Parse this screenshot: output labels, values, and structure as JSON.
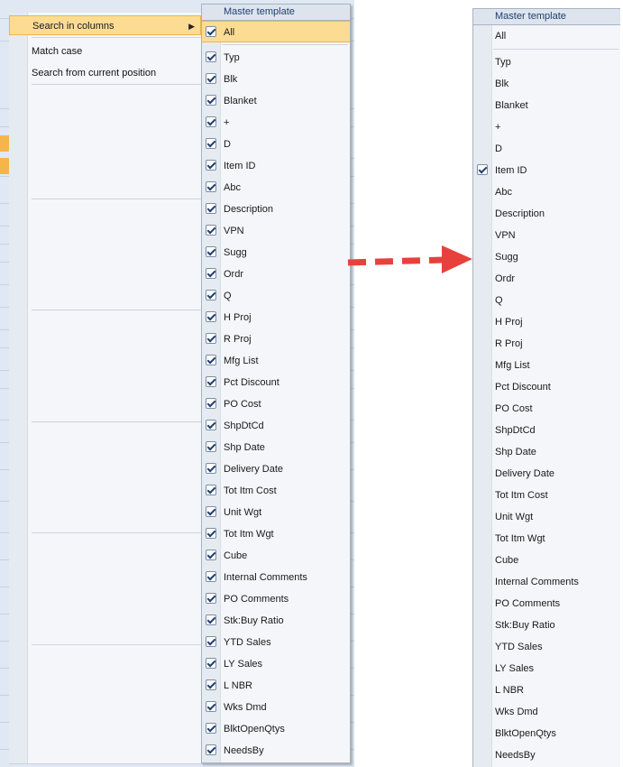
{
  "left_menu": {
    "items": [
      {
        "label": "Search in columns",
        "state": "highlight",
        "submenu": true
      },
      {
        "label": "Match case",
        "state": "active"
      },
      {
        "label": "Search from current position",
        "state": "active"
      },
      {
        "label": "",
        "state": "disabled"
      },
      {
        "label": "",
        "state": "disabled"
      },
      {
        "label": "",
        "state": "disabled"
      },
      {
        "label": "",
        "state": "disabled"
      },
      {
        "label": "",
        "state": "disabled"
      },
      {
        "label": "",
        "state": "disabled"
      },
      {
        "label": "",
        "state": "disabled"
      },
      {
        "label": "",
        "state": "disabled"
      },
      {
        "label": "",
        "state": "disabled"
      },
      {
        "label": "",
        "state": "disabled"
      },
      {
        "label": "",
        "state": "disabled"
      },
      {
        "label": "",
        "state": "disabled"
      },
      {
        "label": "",
        "state": "disabled"
      },
      {
        "label": "",
        "state": "disabled"
      },
      {
        "label": "",
        "state": "disabled"
      },
      {
        "label": "",
        "state": "disabled"
      },
      {
        "label": "",
        "state": "disabled"
      },
      {
        "label": "",
        "state": "disabled"
      },
      {
        "label": "",
        "state": "disabled"
      },
      {
        "label": "",
        "state": "disabled"
      },
      {
        "label": "",
        "state": "disabled"
      },
      {
        "label": "",
        "state": "disabled"
      },
      {
        "label": "",
        "state": "disabled"
      },
      {
        "label": "",
        "state": "disabled"
      },
      {
        "label": "",
        "state": "disabled"
      },
      {
        "label": "",
        "state": "disabled"
      },
      {
        "label": "",
        "state": "disabled"
      },
      {
        "label": "",
        "state": "disabled"
      },
      {
        "label": "",
        "state": "disabled"
      }
    ]
  },
  "panel_before": {
    "title": "Master template",
    "all": {
      "label": "All",
      "checked": true
    },
    "columns": [
      {
        "label": "Typ",
        "checked": true
      },
      {
        "label": "Blk",
        "checked": true
      },
      {
        "label": "Blanket",
        "checked": true
      },
      {
        "label": "+",
        "checked": true
      },
      {
        "label": "D",
        "checked": true
      },
      {
        "label": "Item ID",
        "checked": true
      },
      {
        "label": "Abc",
        "checked": true
      },
      {
        "label": "Description",
        "checked": true
      },
      {
        "label": "VPN",
        "checked": true
      },
      {
        "label": "Sugg",
        "checked": true
      },
      {
        "label": "Ordr",
        "checked": true
      },
      {
        "label": "Q",
        "checked": true
      },
      {
        "label": "H Proj",
        "checked": true
      },
      {
        "label": "R Proj",
        "checked": true
      },
      {
        "label": "Mfg List",
        "checked": true
      },
      {
        "label": "Pct Discount",
        "checked": true
      },
      {
        "label": "PO Cost",
        "checked": true
      },
      {
        "label": "ShpDtCd",
        "checked": true
      },
      {
        "label": "Shp Date",
        "checked": true
      },
      {
        "label": "Delivery Date",
        "checked": true
      },
      {
        "label": "Tot Itm Cost",
        "checked": true
      },
      {
        "label": "Unit Wgt",
        "checked": true
      },
      {
        "label": "Tot Itm Wgt",
        "checked": true
      },
      {
        "label": "Cube",
        "checked": true
      },
      {
        "label": "Internal Comments",
        "checked": true
      },
      {
        "label": "PO Comments",
        "checked": true
      },
      {
        "label": "Stk:Buy Ratio",
        "checked": true
      },
      {
        "label": "YTD Sales",
        "checked": true
      },
      {
        "label": "LY Sales",
        "checked": true
      },
      {
        "label": "L NBR",
        "checked": true
      },
      {
        "label": "Wks Dmd",
        "checked": true
      },
      {
        "label": "BlktOpenQtys",
        "checked": true
      },
      {
        "label": "NeedsBy",
        "checked": true
      }
    ]
  },
  "panel_after": {
    "title": "Master template",
    "all": {
      "label": "All",
      "checked": false
    },
    "columns": [
      {
        "label": "Typ",
        "checked": false
      },
      {
        "label": "Blk",
        "checked": false
      },
      {
        "label": "Blanket",
        "checked": false
      },
      {
        "label": "+",
        "checked": false
      },
      {
        "label": "D",
        "checked": false
      },
      {
        "label": "Item ID",
        "checked": true
      },
      {
        "label": "Abc",
        "checked": false
      },
      {
        "label": "Description",
        "checked": false
      },
      {
        "label": "VPN",
        "checked": false
      },
      {
        "label": "Sugg",
        "checked": false
      },
      {
        "label": "Ordr",
        "checked": false
      },
      {
        "label": "Q",
        "checked": false
      },
      {
        "label": "H Proj",
        "checked": false
      },
      {
        "label": "R Proj",
        "checked": false
      },
      {
        "label": "Mfg List",
        "checked": false
      },
      {
        "label": "Pct Discount",
        "checked": false
      },
      {
        "label": "PO Cost",
        "checked": false
      },
      {
        "label": "ShpDtCd",
        "checked": false
      },
      {
        "label": "Shp Date",
        "checked": false
      },
      {
        "label": "Delivery Date",
        "checked": false
      },
      {
        "label": "Tot Itm Cost",
        "checked": false
      },
      {
        "label": "Unit Wgt",
        "checked": false
      },
      {
        "label": "Tot Itm Wgt",
        "checked": false
      },
      {
        "label": "Cube",
        "checked": false
      },
      {
        "label": "Internal Comments",
        "checked": false
      },
      {
        "label": "PO Comments",
        "checked": false
      },
      {
        "label": "Stk:Buy Ratio",
        "checked": false
      },
      {
        "label": "YTD Sales",
        "checked": false
      },
      {
        "label": "LY Sales",
        "checked": false
      },
      {
        "label": "L NBR",
        "checked": false
      },
      {
        "label": "Wks Dmd",
        "checked": false
      },
      {
        "label": "BlktOpenQtys",
        "checked": false
      },
      {
        "label": "NeedsBy",
        "checked": false
      }
    ]
  },
  "colors": {
    "highlight": "#fbdc92",
    "highlight_border": "#e9b84a",
    "arrow": "#e8413c",
    "menu_bg": "#f4f6f9",
    "title_text": "#1f3f6e"
  }
}
